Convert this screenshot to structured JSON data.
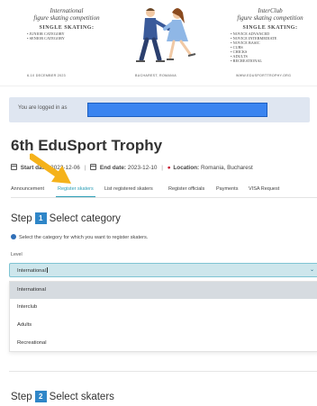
{
  "banner": {
    "left_script": "International\nfigure skating competition",
    "left_heading": "SINGLE SKATING:",
    "left_lines": [
      "Junior category",
      "Senior category"
    ],
    "right_script": "InterClub\nfigure skating competition",
    "right_heading": "SINGLE SKATING:",
    "right_lines": [
      "Novice advanced",
      "Novice intermediate",
      "Novice basic",
      "Cubs",
      "Chicks",
      "Adults",
      "Recreational"
    ],
    "foot_dates": "6-10 December 2023",
    "foot_venue": "Bucharest, Romania",
    "foot_site": "www.edusporttrophy.org"
  },
  "logged": {
    "text": "You are logged in as"
  },
  "event": {
    "title": "6th EduSport Trophy",
    "start_label": "Start date:",
    "start_value": "2023-12-06",
    "end_label": "End date:",
    "end_value": "2023-12-10",
    "location_label": "Location:",
    "location_value": "Romania, Bucharest"
  },
  "tabs": [
    {
      "label": "Announcement"
    },
    {
      "label": "Register skaters"
    },
    {
      "label": "List registered skaters"
    },
    {
      "label": "Register officials"
    },
    {
      "label": "Payments"
    },
    {
      "label": "VISA Request"
    }
  ],
  "step1": {
    "word": "Step",
    "number": "1",
    "title": "Select category",
    "hint": "Select the category for which you want to register skaters.",
    "level_label": "Level",
    "selected_value": "International",
    "options": [
      "International",
      "Interclub",
      "Adults",
      "Recreational"
    ]
  },
  "step2": {
    "word": "Step",
    "number": "2",
    "title": "Select skaters"
  },
  "colors": {
    "accent": "#2a9db5",
    "step_badge": "#2f86c8",
    "arrow": "#f5b21b",
    "redaction": "#3a84f0"
  }
}
